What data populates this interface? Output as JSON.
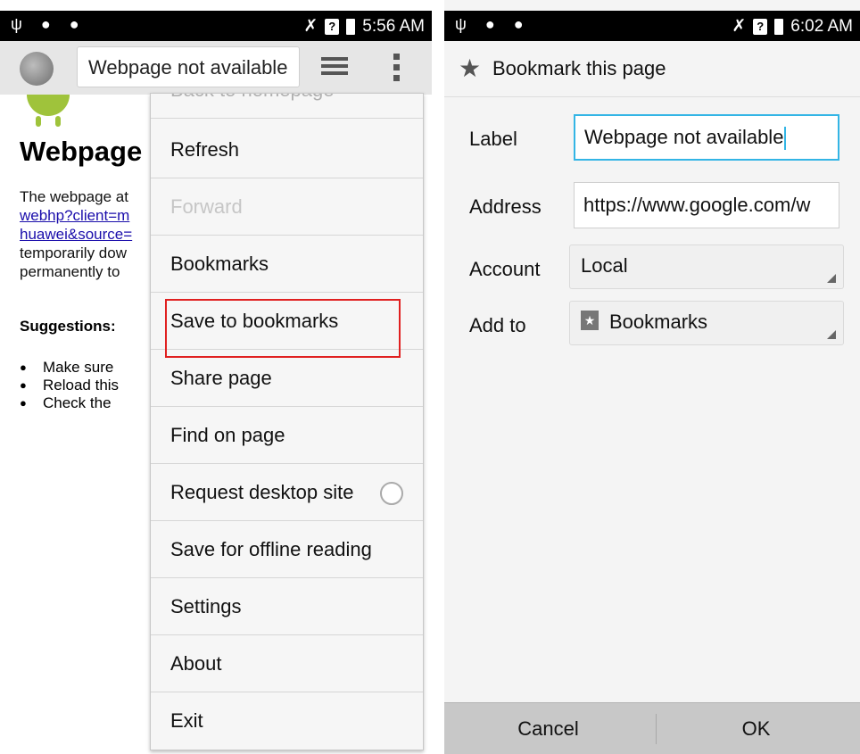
{
  "left": {
    "status_time": "5:56 AM",
    "url": "Webpage not available",
    "page": {
      "title": "Webpage not available",
      "body_lines": [
        "The webpage at",
        "webhp?client=m",
        "huawei&source=",
        "temporarily dow",
        "permanently to"
      ],
      "suggestions_heading": "Suggestions:",
      "suggestions": [
        "Make sure",
        "Reload this",
        "Check the"
      ]
    },
    "menu": {
      "partial_item": "Back to homepage",
      "items": [
        {
          "label": "Refresh"
        },
        {
          "label": "Forward"
        },
        {
          "label": "Bookmarks"
        },
        {
          "label": "Save to bookmarks"
        },
        {
          "label": "Share page"
        },
        {
          "label": "Find on page"
        },
        {
          "label": "Request desktop site"
        },
        {
          "label": "Save for offline reading"
        },
        {
          "label": "Settings"
        },
        {
          "label": "About"
        },
        {
          "label": "Exit"
        }
      ]
    }
  },
  "right": {
    "status_time": "6:02 AM",
    "dialog_title": "Bookmark this page",
    "fields": {
      "label_caption": "Label",
      "label_value": "Webpage not available",
      "address_caption": "Address",
      "address_value": "https://www.google.com/w",
      "account_caption": "Account",
      "account_value": "Local",
      "addto_caption": "Add to",
      "addto_value": "Bookmarks"
    },
    "buttons": {
      "cancel": "Cancel",
      "ok": "OK"
    }
  },
  "colors": {
    "accent": "#33b5e5",
    "highlight": "#e02020",
    "link": "#1a0dab"
  }
}
